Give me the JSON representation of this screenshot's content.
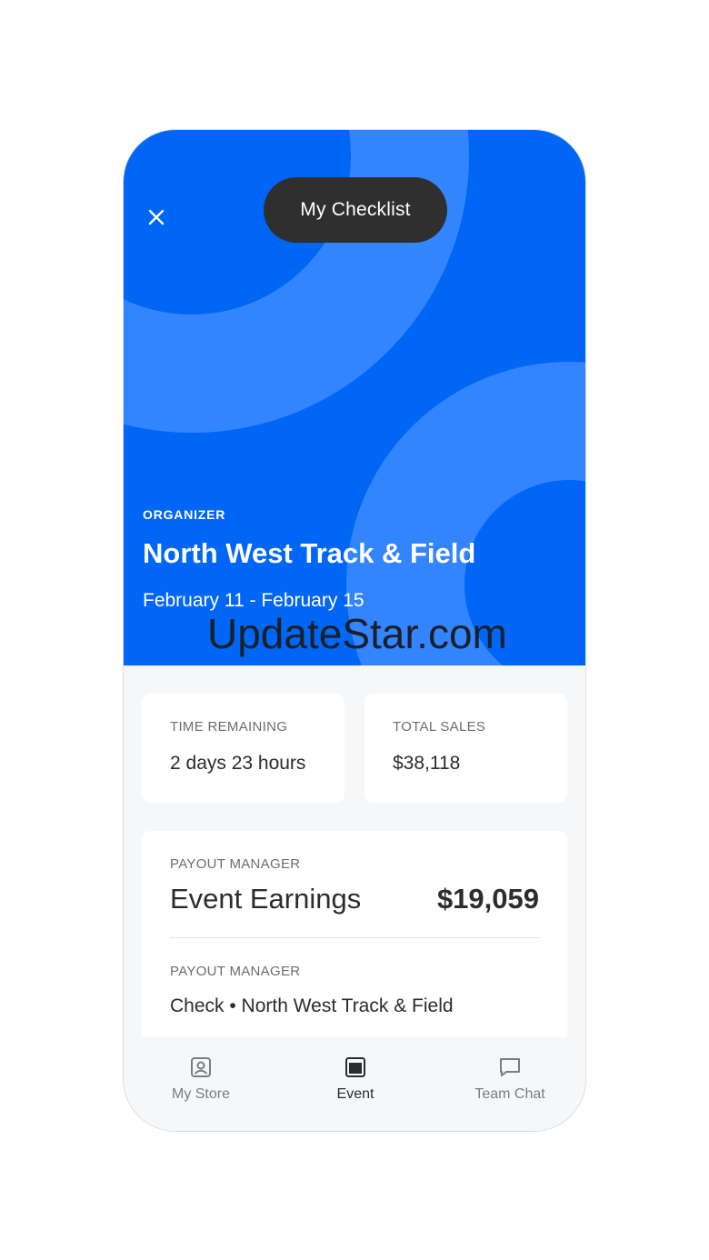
{
  "header": {
    "close_icon": "close-icon",
    "checklist_label": "My Checklist"
  },
  "event": {
    "role": "ORGANIZER",
    "title": "North West Track & Field",
    "dates": "February 11 - February 15"
  },
  "watermark": "UpdateStar.com",
  "stats": {
    "time_remaining": {
      "label": "TIME REMAINING",
      "value": "2 days 23 hours"
    },
    "total_sales": {
      "label": "TOTAL SALES",
      "value": "$38,118"
    }
  },
  "payout": {
    "section_label": "PAYOUT MANAGER",
    "earnings_label": "Event Earnings",
    "earnings_value": "$19,059",
    "method_label": "PAYOUT MANAGER",
    "method_value": "Check • North West Track & Field"
  },
  "tabs": [
    {
      "label": "My Store",
      "icon": "store-icon",
      "active": false
    },
    {
      "label": "Event",
      "icon": "event-icon",
      "active": true
    },
    {
      "label": "Team Chat",
      "icon": "chat-icon",
      "active": false
    }
  ],
  "colors": {
    "hero_blue": "#0066f5",
    "hero_ring": "#3385ff",
    "pill_bg": "#2f2f30",
    "text_dark": "#2b2c2f",
    "text_muted": "#6b6d72",
    "page_bg": "#f6f7f9"
  }
}
